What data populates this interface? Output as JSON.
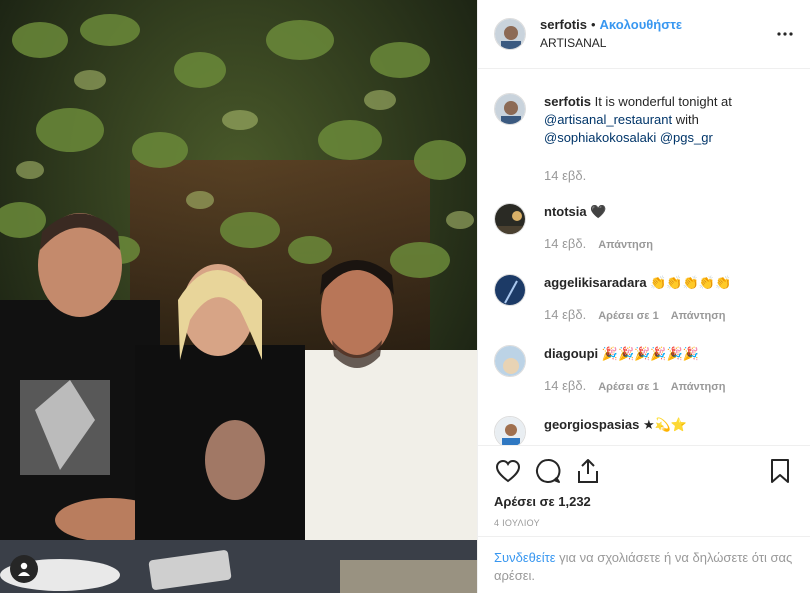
{
  "post": {
    "author": "serfotis",
    "follow_label": "Ακολουθήστε",
    "separator": "•",
    "location": "ARTISANAL",
    "caption_prefix": "It is wonderful tonight at",
    "caption_mentions": [
      "@artisanal_restaurant",
      "with",
      "@sophiakokosalaki",
      "@pgs_gr"
    ],
    "caption_time": "14 εβδ."
  },
  "comments": [
    {
      "user": "ntotsia",
      "text": "🖤",
      "time": "14 εβδ.",
      "likes": "",
      "reply": "Απάντηση"
    },
    {
      "user": "aggelikisaradara",
      "text": "👏👏👏👏👏",
      "time": "14 εβδ.",
      "likes": "Αρέσει σε 1",
      "reply": "Απάντηση"
    },
    {
      "user": "diagoupi",
      "text": "🎉🎉🎉🎉🎉🎉",
      "time": "14 εβδ.",
      "likes": "Αρέσει σε 1",
      "reply": "Απάντηση"
    },
    {
      "user": "georgiospasias",
      "text": "★💫⭐",
      "time": "",
      "likes": "",
      "reply": ""
    }
  ],
  "footer": {
    "likes": "Αρέσει σε 1,232",
    "date": "4 ΙΟΥΛΙΟΥ",
    "login_link": "Συνδεθείτε",
    "login_text": "για να σχολιάσετε ή να δηλώσετε ότι σας αρέσει."
  },
  "icons": {
    "like": "heart-icon",
    "comment": "comment-icon",
    "share": "share-icon",
    "save": "bookmark-icon",
    "more": "more-options-icon",
    "tag": "user-tag-icon"
  },
  "colors": {
    "link": "#3897f0",
    "text": "#262626",
    "muted": "#999999",
    "mention": "#003569"
  }
}
